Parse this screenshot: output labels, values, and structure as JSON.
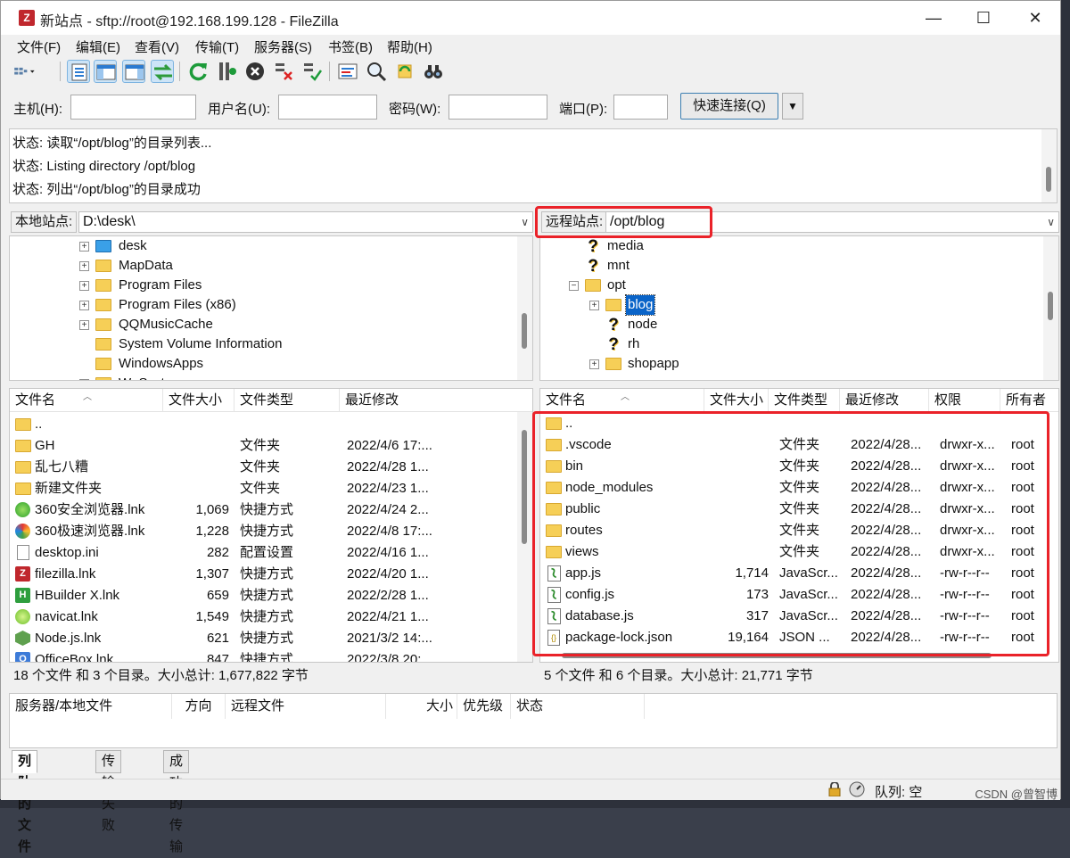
{
  "window": {
    "title": "新站点 - sftp://root@192.168.199.128 - FileZilla",
    "min": "—",
    "max": "☐",
    "close": "✕"
  },
  "menu": [
    "文件(F)",
    "编辑(E)",
    "查看(V)",
    "传输(T)",
    "服务器(S)",
    "书签(B)",
    "帮助(H)"
  ],
  "quickconnect": {
    "host_label": "主机(H):",
    "user_label": "用户名(U):",
    "pass_label": "密码(W):",
    "port_label": "端口(P):",
    "connect_label": "快速连接(Q)",
    "dropdown": "▼"
  },
  "log": [
    "状态: 读取“/opt/blog”的目录列表...",
    "状态: Listing directory /opt/blog",
    "状态: 列出“/opt/blog”的目录成功"
  ],
  "local": {
    "site_label": "本地站点:",
    "path": "D:\\desk\\",
    "tree": [
      "desk",
      "MapData",
      "Program Files",
      "Program Files (x86)",
      "QQMusicCache",
      "System Volume Information",
      "WindowsApps",
      "WpSystem"
    ],
    "columns": [
      "文件名",
      "文件大小",
      "文件类型",
      "最近修改"
    ],
    "files": [
      {
        "name": "..",
        "size": "",
        "type": "",
        "date": "",
        "icon": "folder"
      },
      {
        "name": "GH",
        "size": "",
        "type": "文件夹",
        "date": "2022/4/6 17:...",
        "icon": "folder"
      },
      {
        "name": "乱七八糟",
        "size": "",
        "type": "文件夹",
        "date": "2022/4/28 1...",
        "icon": "folder"
      },
      {
        "name": "新建文件夹",
        "size": "",
        "type": "文件夹",
        "date": "2022/4/23 1...",
        "icon": "folder"
      },
      {
        "name": "360安全浏览器.lnk",
        "size": "1,069",
        "type": "快捷方式",
        "date": "2022/4/24 2...",
        "icon": "green-round"
      },
      {
        "name": "360极速浏览器.lnk",
        "size": "1,228",
        "type": "快捷方式",
        "date": "2022/4/8 17:...",
        "icon": "multi-round"
      },
      {
        "name": "desktop.ini",
        "size": "282",
        "type": "配置设置",
        "date": "2022/4/16 1...",
        "icon": "file"
      },
      {
        "name": "filezilla.lnk",
        "size": "1,307",
        "type": "快捷方式",
        "date": "2022/4/20 1...",
        "icon": "red-box"
      },
      {
        "name": "HBuilder X.lnk",
        "size": "659",
        "type": "快捷方式",
        "date": "2022/2/28 1...",
        "icon": "green-box"
      },
      {
        "name": "navicat.lnk",
        "size": "1,549",
        "type": "快捷方式",
        "date": "2022/4/21 1...",
        "icon": "lime-round"
      },
      {
        "name": "Node.js.lnk",
        "size": "621",
        "type": "快捷方式",
        "date": "2021/3/2 14:...",
        "icon": "node-hex"
      },
      {
        "name": "OfficeBox.lnk",
        "size": "847",
        "type": "快捷方式",
        "date": "2022/3/8 20:...",
        "icon": "blue-box"
      }
    ],
    "status": "18 个文件 和 3 个目录。大小总计: 1,677,822 字节"
  },
  "remote": {
    "site_label": "远程站点:",
    "path": "/opt/blog",
    "tree": [
      {
        "name": "media",
        "icon": "question"
      },
      {
        "name": "mnt",
        "icon": "question"
      },
      {
        "name": "opt",
        "icon": "folder"
      },
      {
        "name": "blog",
        "icon": "folder"
      },
      {
        "name": "node",
        "icon": "question"
      },
      {
        "name": "rh",
        "icon": "question"
      },
      {
        "name": "shopapp",
        "icon": "folder"
      }
    ],
    "columns": [
      "文件名",
      "文件大小",
      "文件类型",
      "最近修改",
      "权限",
      "所有者"
    ],
    "files": [
      {
        "name": "..",
        "size": "",
        "type": "",
        "date": "",
        "perm": "",
        "owner": "",
        "icon": "folder"
      },
      {
        "name": ".vscode",
        "size": "",
        "type": "文件夹",
        "date": "2022/4/28...",
        "perm": "drwxr-x...",
        "owner": "root",
        "icon": "folder"
      },
      {
        "name": "bin",
        "size": "",
        "type": "文件夹",
        "date": "2022/4/28...",
        "perm": "drwxr-x...",
        "owner": "root",
        "icon": "folder"
      },
      {
        "name": "node_modules",
        "size": "",
        "type": "文件夹",
        "date": "2022/4/28...",
        "perm": "drwxr-x...",
        "owner": "root",
        "icon": "folder"
      },
      {
        "name": "public",
        "size": "",
        "type": "文件夹",
        "date": "2022/4/28...",
        "perm": "drwxr-x...",
        "owner": "root",
        "icon": "folder"
      },
      {
        "name": "routes",
        "size": "",
        "type": "文件夹",
        "date": "2022/4/28...",
        "perm": "drwxr-x...",
        "owner": "root",
        "icon": "folder"
      },
      {
        "name": "views",
        "size": "",
        "type": "文件夹",
        "date": "2022/4/28...",
        "perm": "drwxr-x...",
        "owner": "root",
        "icon": "folder"
      },
      {
        "name": "app.js",
        "size": "1,714",
        "type": "JavaScr...",
        "date": "2022/4/28...",
        "perm": "-rw-r--r--",
        "owner": "root",
        "icon": "js"
      },
      {
        "name": "config.js",
        "size": "173",
        "type": "JavaScr...",
        "date": "2022/4/28...",
        "perm": "-rw-r--r--",
        "owner": "root",
        "icon": "js"
      },
      {
        "name": "database.js",
        "size": "317",
        "type": "JavaScr...",
        "date": "2022/4/28...",
        "perm": "-rw-r--r--",
        "owner": "root",
        "icon": "js"
      },
      {
        "name": "package-lock.json",
        "size": "19,164",
        "type": "JSON ...",
        "date": "2022/4/28...",
        "perm": "-rw-r--r--",
        "owner": "root",
        "icon": "json"
      }
    ],
    "status": "5 个文件 和 6 个目录。大小总计: 21,771 字节"
  },
  "queue": {
    "columns": [
      "服务器/本地文件",
      "方向",
      "远程文件",
      "大小",
      "优先级",
      "状态"
    ]
  },
  "tabs": [
    "列队的文件",
    "传输失败",
    "成功的传输"
  ],
  "statusbar": {
    "queue": "队列: 空"
  },
  "watermark": "CSDN @曾智博",
  "colors": {
    "accent_select": "#0a64c8",
    "highlight_box": "#ea2229",
    "folder": "#f6cf57"
  }
}
